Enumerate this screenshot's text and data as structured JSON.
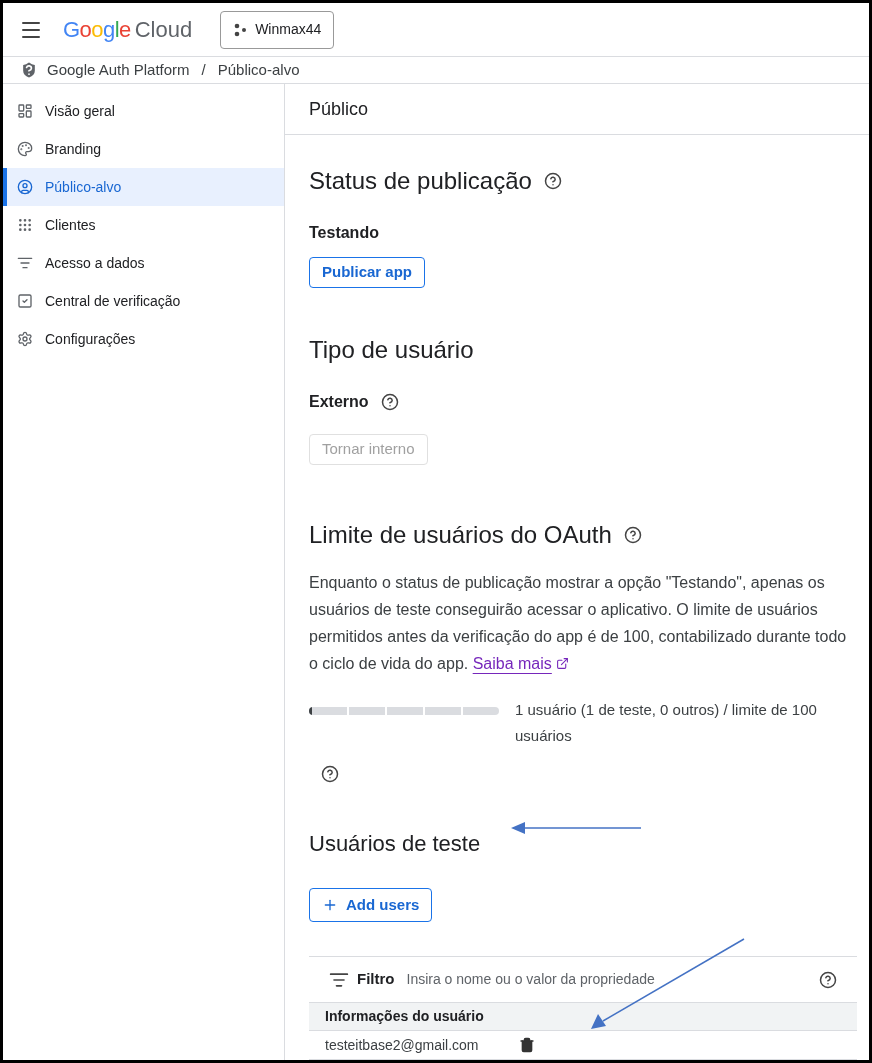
{
  "header": {
    "logo_word": "Google",
    "logo_product": "Cloud",
    "project": "Winmax44"
  },
  "breadcrumb": {
    "items": [
      "Google Auth Platform",
      "Público-alvo"
    ],
    "separator": "/"
  },
  "sidebar": {
    "items": [
      {
        "label": "Visão geral",
        "selected": false
      },
      {
        "label": "Branding",
        "selected": false
      },
      {
        "label": "Público-alvo",
        "selected": true
      },
      {
        "label": "Clientes",
        "selected": false
      },
      {
        "label": "Acesso a dados",
        "selected": false
      },
      {
        "label": "Central de verificação",
        "selected": false
      },
      {
        "label": "Configurações",
        "selected": false
      }
    ]
  },
  "page_title": "Público",
  "publishing_status": {
    "heading": "Status de publicação",
    "status": "Testando",
    "button": "Publicar app"
  },
  "user_type": {
    "heading": "Tipo de usuário",
    "type": "Externo",
    "button": {
      "label": "Tornar interno",
      "disabled": true
    }
  },
  "oauth_limit": {
    "heading": "Limite de usuários do OAuth",
    "description": "Enquanto o status de publicação mostrar a opção \"Testando\", apenas os usuários de teste conseguirão acessar o aplicativo. O limite de usuários permitidos antes da verificação do app é de 100, contabilizado durante todo o ciclo de vida do app.",
    "link": "Saiba mais",
    "level": 0.01,
    "reading": "1 usuário (1 de teste, 0 outros) / limite de 100 usuários"
  },
  "test_users": {
    "heading": "Usuários de teste",
    "add_button": "Add users",
    "filter_label": "Filtro",
    "filter_placeholder": "Insira o nome ou o valor da propriedade",
    "column": "Informações do usuário",
    "rows": [
      {
        "email": "testeitbase2@gmail.com"
      }
    ]
  }
}
